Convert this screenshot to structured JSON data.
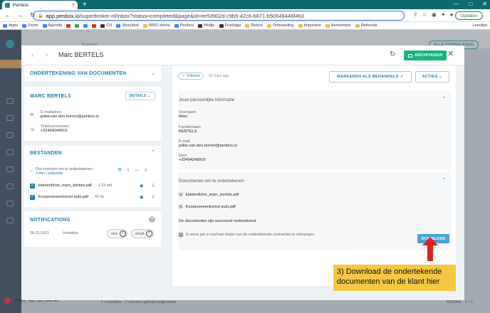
{
  "browser": {
    "tab_title": "Penbox",
    "url_host": "app.penbox.io",
    "url_path": "/superbroker-nl/inbox?status=completed&page&id=ee53902d-c9b5-42c6-b871-b50649446f463",
    "update_label": "Updaten",
    "bookmarks": [
      "Apps",
      "Zoom",
      "Agenda",
      "",
      "",
      "",
      "",
      "CU",
      "Storyblok",
      "BRIO demo",
      "Penbox",
      "Modjo",
      "Frontapp",
      "Retool",
      "Onboarding",
      "Important",
      "Remember",
      "Referrals"
    ],
    "reading_list": "Leeslijst"
  },
  "background": {
    "page_breadcrumb": "Zoeken",
    "filters_button": "ALLE FORMULIEREN",
    "user_name": "Jelkie Van den Borren",
    "results": "1 resultaten  ·  7 minuten geleden bijgewerkt",
    "pagina_label": "PAGINA",
    "pagina_value": "1 / 1"
  },
  "modal": {
    "title": "Marc BERTELS",
    "archive_label": "ARCHIVEREN",
    "signing_title": "ONDERTEKENING VAN DOCUMENTEN",
    "contact": {
      "title": "MARC BERTELS",
      "details_label": "DETAILS",
      "email_label": "E-mailadres",
      "email_value": "jelkie.van.den.borren@penbox.io",
      "phone_label": "Telefoonnummer",
      "phone_value": "+32494249919"
    },
    "files": {
      "title": "BESTANDEN",
      "group_label": "Documenten om te ondertekenen",
      "group_sub": "2 files ( selected)",
      "items": [
        {
          "name": "klantenfiche_marc_bertels.pdf",
          "size": "1.23 mb"
        },
        {
          "name": "Koopovereenkomst auto.pdf",
          "size": "42 kb"
        }
      ]
    },
    "notifications": {
      "title": "NOTIFICATIONS",
      "date": "28-11-2021",
      "type": "Invitation",
      "sms": "sms",
      "email": "email"
    },
    "right": {
      "status": "Voltooid",
      "age": "83 days ago",
      "mark_button": "MARKEREN ALS BEHANDELD",
      "actions_button": "ACTIES",
      "personal_section": "Jouw persoonlijke informatie",
      "fields": [
        {
          "label": "Voornaam",
          "value": "Marc"
        },
        {
          "label": "Familienaam",
          "value": "BERTELS"
        },
        {
          "label": "E-mail",
          "value": "jelkie.van.den.borren@penbox.io"
        },
        {
          "label": "Gsm",
          "value": "+32494249919"
        }
      ],
      "docs_section": "Documenten om te ondertekenen",
      "docs": [
        "klantenfiche_marc_bertels.pdf",
        "Koopovereenkomst auto.pdf"
      ],
      "signed_text": "De documenten zijn succesvol ondertekend.",
      "download_label": "DOWNLOAD",
      "copy_text": "Ik wens per e-mail een kopie van de ondertekende contracten te ontvangen"
    }
  },
  "annotation": {
    "line1": "3) Download de ondertekende",
    "line2": "documenten van de klant hier"
  },
  "colors": {
    "accent": "#1a7fb0",
    "archive": "#18b37e",
    "download": "#4aa3d8",
    "arrow": "#e02020",
    "callout": "#f6c744"
  }
}
